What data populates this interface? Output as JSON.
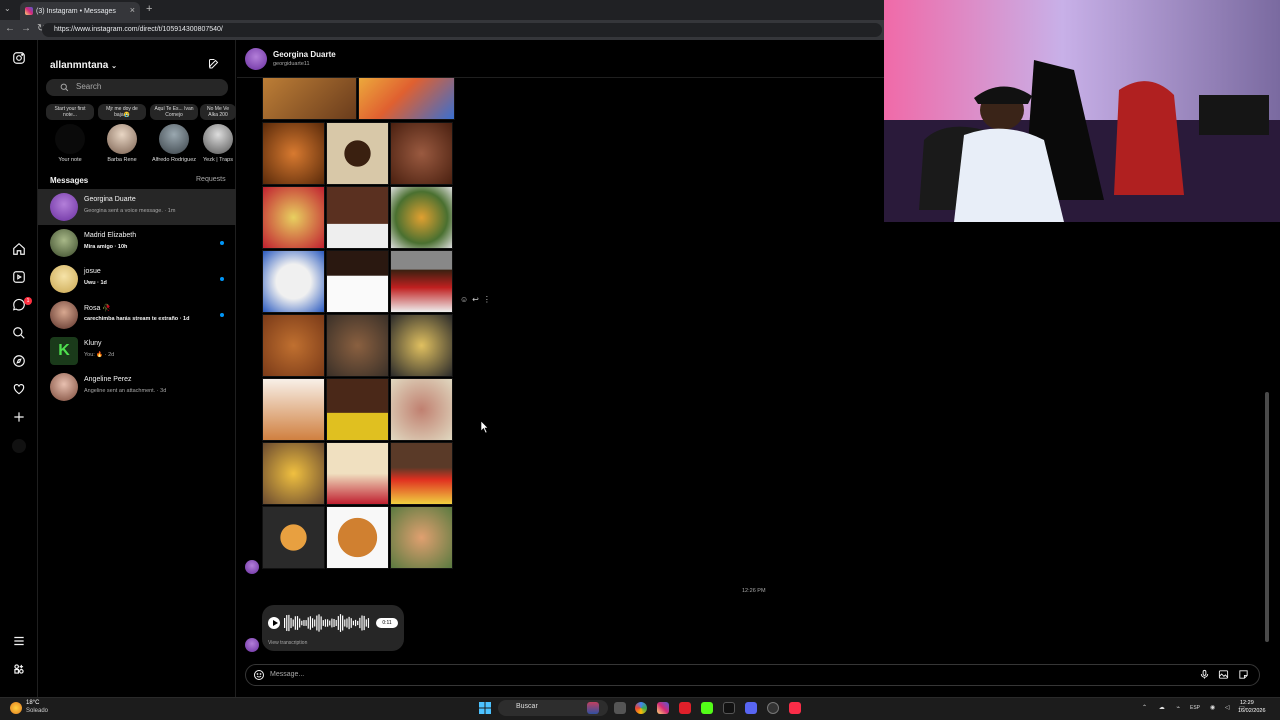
{
  "browser": {
    "tab_title": "(3) Instagram • Messages",
    "url": "https://www.instagram.com/direct/t/105914300807540/"
  },
  "sidebar": {
    "username": "allanmntana",
    "search_placeholder": "Search",
    "messages_heading": "Messages",
    "requests_label": "Requests",
    "notification_count": "1",
    "notes": [
      {
        "bubble": "Start your first note...",
        "label": "Your note"
      },
      {
        "bubble": "Mjr me doy de baja😭",
        "label": "Barba Rene"
      },
      {
        "bubble": "Aquí Te Es... Ivan Cornejo",
        "label": "Alfredo Rodriguez"
      },
      {
        "bubble": "No Me Ve Alka 200",
        "label": "Yezk | Traps"
      }
    ],
    "conversations": [
      {
        "name": "Georgina Duarte",
        "preview": "Georgina sent a voice message. · 1m",
        "unread": false,
        "selected": true,
        "avatar_color": "#7b3fb3"
      },
      {
        "name": "Madrid Elizabeth",
        "preview": "Mira amigo · 10h",
        "unread": true,
        "selected": false,
        "avatar_color": "#5a6e4a"
      },
      {
        "name": "josue",
        "preview": "Uwu · 1d",
        "unread": true,
        "selected": false,
        "avatar_color": "#d9c27a"
      },
      {
        "name": "Rosa 🥀",
        "preview": "carechimba harás stream te extraño · 1d",
        "unread": true,
        "selected": false,
        "avatar_color": "#a07060"
      },
      {
        "name": "Kluny",
        "preview": "You: 🔥 · 2d",
        "unread": false,
        "selected": false,
        "avatar_color": "#1f6b2a"
      },
      {
        "name": "Angeline Perez",
        "preview": "Angeline sent an attachment. · 3d",
        "unread": false,
        "selected": false,
        "avatar_color": "#b07868"
      }
    ]
  },
  "chat": {
    "contact_name": "Georgina Duarte",
    "contact_handle": "georgiduarte11",
    "timestamp": "12:26 PM",
    "voice_duration": "0:11",
    "view_transcription": "View transcription",
    "message_placeholder": "Message..."
  },
  "taskbar": {
    "weather_temp": "18°C",
    "weather_desc": "Soleado",
    "search_label": "Buscar",
    "language": "ESP",
    "time": "12:29",
    "date": "16/02/2026"
  },
  "icons": [
    "instagram-icon",
    "home-icon",
    "reels-icon",
    "messenger-icon",
    "search-icon",
    "explore-icon",
    "heart-icon",
    "create-icon",
    "menu-icon",
    "meta-icon",
    "compose-icon",
    "microphone-icon",
    "image-icon",
    "sticker-icon"
  ]
}
